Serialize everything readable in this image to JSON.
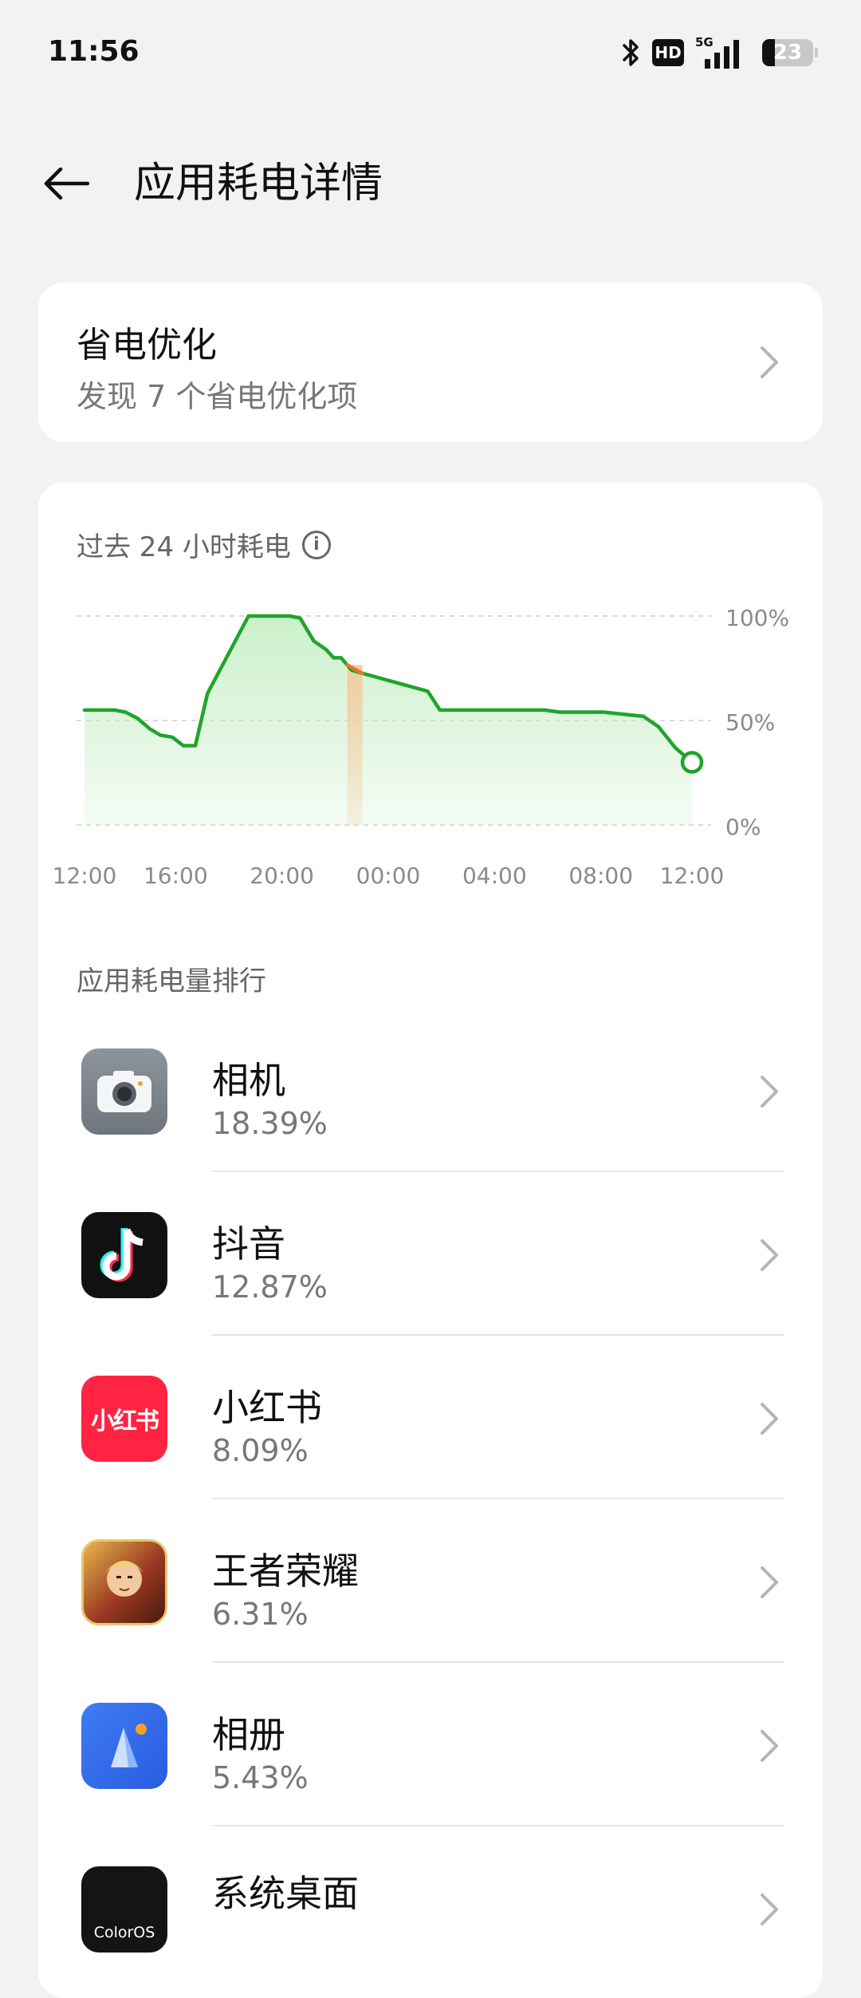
{
  "status": {
    "time": "11:56",
    "hd": "HD",
    "network": "5G",
    "battery": "23"
  },
  "header": {
    "title": "应用耗电详情"
  },
  "optimization": {
    "title": "省电优化",
    "subtitle": "发现 7 个省电优化项"
  },
  "chart_section": {
    "title": "过去 24 小时耗电"
  },
  "chart_data": {
    "type": "area",
    "title": "过去 24 小时耗电",
    "x_tick_labels": [
      "12:00",
      "16:00",
      "20:00",
      "00:00",
      "04:00",
      "08:00",
      "12:00"
    ],
    "y_tick_labels": [
      "100%",
      "50%",
      "0%"
    ],
    "ylim": [
      0,
      100
    ],
    "x_hours_since_start": [
      0,
      2,
      2.7,
      3.5,
      4.3,
      5,
      5.8,
      6.5,
      7.3,
      8.1,
      10.8,
      11.7,
      13.5,
      14.2,
      15.1,
      15.9,
      16.4,
      16.9,
      17.6,
      22.6,
      23.4,
      30.3,
      31.3,
      34.2,
      35.5,
      36.8,
      37.8,
      38.9,
      40.0
    ],
    "values": [
      55,
      55,
      54,
      51,
      46,
      43,
      42,
      38,
      38,
      63,
      100,
      100,
      100,
      99,
      88,
      84,
      80,
      80,
      74,
      64,
      55,
      55,
      54,
      54,
      53,
      52,
      47,
      37,
      30
    ],
    "charging_highlight_x": [
      17.3,
      18.3
    ],
    "grid": true,
    "legend": "none",
    "colors": {
      "line": "#1fa52a",
      "fill": "#c9efc8",
      "highlight": "#f5c89a",
      "highlight_line": "#e07b2a"
    }
  },
  "ranking": {
    "title": "应用耗电量排行",
    "apps": [
      {
        "name": "相机",
        "percent": "18.39%",
        "icon": "camera-icon"
      },
      {
        "name": "抖音",
        "percent": "12.87%",
        "icon": "douyin-icon"
      },
      {
        "name": "小红书",
        "percent": "8.09%",
        "icon": "xiaohongshu-icon",
        "icon_text": "小红书"
      },
      {
        "name": "王者荣耀",
        "percent": "6.31%",
        "icon": "honor-of-kings-icon"
      },
      {
        "name": "相册",
        "percent": "5.43%",
        "icon": "gallery-icon"
      },
      {
        "name": "系统桌面",
        "percent": "",
        "icon": "coloros-icon",
        "icon_text": "ColorOS"
      }
    ]
  }
}
